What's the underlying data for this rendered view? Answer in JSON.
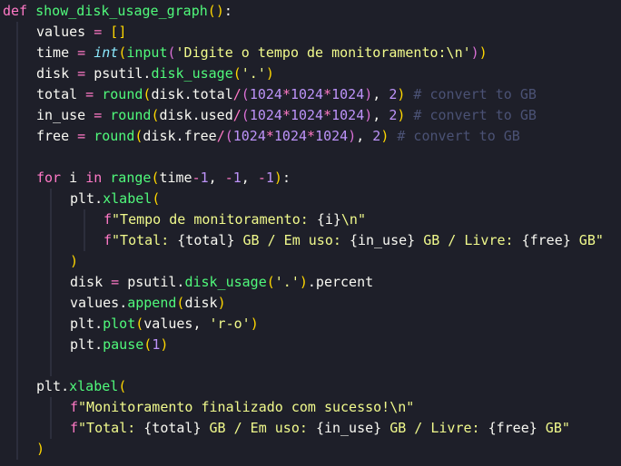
{
  "colors": {
    "background": "#1e1f29",
    "kw": "#ff79c6",
    "fn": "#50fa7b",
    "var": "#f8f8f2",
    "op": "#ff79c6",
    "str": "#f1fa8c",
    "num": "#bd93f9",
    "cmt": "#4b5275",
    "p1": "#ffd700",
    "p2": "#da70d6",
    "p3": "#179fff",
    "guide": "#3a3d4f"
  },
  "code": {
    "lines": [
      {
        "indent": 0,
        "tokens": [
          {
            "t": "def",
            "c": "kw"
          },
          {
            "t": " ",
            "c": "var"
          },
          {
            "t": "show_disk_usage_graph",
            "c": "fn"
          },
          {
            "t": "(",
            "c": "p1"
          },
          {
            "t": ")",
            "c": "p1"
          },
          {
            "t": ":",
            "c": "var"
          }
        ]
      },
      {
        "indent": 1,
        "tokens": [
          {
            "t": "values",
            "c": "var"
          },
          {
            "t": " = ",
            "c": "op"
          },
          {
            "t": "[",
            "c": "p1"
          },
          {
            "t": "]",
            "c": "p1"
          }
        ]
      },
      {
        "indent": 1,
        "tokens": [
          {
            "t": "time",
            "c": "var"
          },
          {
            "t": " = ",
            "c": "op"
          },
          {
            "t": "int",
            "c": "kwi"
          },
          {
            "t": "(",
            "c": "p1"
          },
          {
            "t": "input",
            "c": "fn"
          },
          {
            "t": "(",
            "c": "p2"
          },
          {
            "t": "'Digite o tempo de monitoramento:\\n'",
            "c": "str"
          },
          {
            "t": ")",
            "c": "p2"
          },
          {
            "t": ")",
            "c": "p1"
          }
        ]
      },
      {
        "indent": 1,
        "tokens": [
          {
            "t": "disk",
            "c": "var"
          },
          {
            "t": " = ",
            "c": "op"
          },
          {
            "t": "psutil",
            "c": "var"
          },
          {
            "t": ".",
            "c": "var"
          },
          {
            "t": "disk_usage",
            "c": "fn"
          },
          {
            "t": "(",
            "c": "p1"
          },
          {
            "t": "'.'",
            "c": "str"
          },
          {
            "t": ")",
            "c": "p1"
          }
        ]
      },
      {
        "indent": 1,
        "tokens": [
          {
            "t": "total",
            "c": "var"
          },
          {
            "t": " = ",
            "c": "op"
          },
          {
            "t": "round",
            "c": "fn"
          },
          {
            "t": "(",
            "c": "p1"
          },
          {
            "t": "disk",
            "c": "var"
          },
          {
            "t": ".",
            "c": "var"
          },
          {
            "t": "total",
            "c": "var"
          },
          {
            "t": "/",
            "c": "op"
          },
          {
            "t": "(",
            "c": "p2"
          },
          {
            "t": "1024",
            "c": "num"
          },
          {
            "t": "*",
            "c": "op"
          },
          {
            "t": "1024",
            "c": "num"
          },
          {
            "t": "*",
            "c": "op"
          },
          {
            "t": "1024",
            "c": "num"
          },
          {
            "t": ")",
            "c": "p2"
          },
          {
            "t": ", ",
            "c": "var"
          },
          {
            "t": "2",
            "c": "num"
          },
          {
            "t": ")",
            "c": "p1"
          },
          {
            "t": " # convert to GB",
            "c": "cmt"
          }
        ]
      },
      {
        "indent": 1,
        "tokens": [
          {
            "t": "in_use",
            "c": "var"
          },
          {
            "t": " = ",
            "c": "op"
          },
          {
            "t": "round",
            "c": "fn"
          },
          {
            "t": "(",
            "c": "p1"
          },
          {
            "t": "disk",
            "c": "var"
          },
          {
            "t": ".",
            "c": "var"
          },
          {
            "t": "used",
            "c": "var"
          },
          {
            "t": "/",
            "c": "op"
          },
          {
            "t": "(",
            "c": "p2"
          },
          {
            "t": "1024",
            "c": "num"
          },
          {
            "t": "*",
            "c": "op"
          },
          {
            "t": "1024",
            "c": "num"
          },
          {
            "t": "*",
            "c": "op"
          },
          {
            "t": "1024",
            "c": "num"
          },
          {
            "t": ")",
            "c": "p2"
          },
          {
            "t": ", ",
            "c": "var"
          },
          {
            "t": "2",
            "c": "num"
          },
          {
            "t": ")",
            "c": "p1"
          },
          {
            "t": " # convert to GB",
            "c": "cmt"
          }
        ]
      },
      {
        "indent": 1,
        "tokens": [
          {
            "t": "free",
            "c": "var"
          },
          {
            "t": " = ",
            "c": "op"
          },
          {
            "t": "round",
            "c": "fn"
          },
          {
            "t": "(",
            "c": "p1"
          },
          {
            "t": "disk",
            "c": "var"
          },
          {
            "t": ".",
            "c": "var"
          },
          {
            "t": "free",
            "c": "var"
          },
          {
            "t": "/",
            "c": "op"
          },
          {
            "t": "(",
            "c": "p2"
          },
          {
            "t": "1024",
            "c": "num"
          },
          {
            "t": "*",
            "c": "op"
          },
          {
            "t": "1024",
            "c": "num"
          },
          {
            "t": "*",
            "c": "op"
          },
          {
            "t": "1024",
            "c": "num"
          },
          {
            "t": ")",
            "c": "p2"
          },
          {
            "t": ", ",
            "c": "var"
          },
          {
            "t": "2",
            "c": "num"
          },
          {
            "t": ")",
            "c": "p1"
          },
          {
            "t": " # convert to GB",
            "c": "cmt"
          }
        ]
      },
      {
        "indent": 0,
        "tokens": []
      },
      {
        "indent": 1,
        "tokens": [
          {
            "t": "for",
            "c": "kw"
          },
          {
            "t": " i ",
            "c": "var"
          },
          {
            "t": "in",
            "c": "kw"
          },
          {
            "t": " ",
            "c": "var"
          },
          {
            "t": "range",
            "c": "fn"
          },
          {
            "t": "(",
            "c": "p1"
          },
          {
            "t": "time",
            "c": "var"
          },
          {
            "t": "-",
            "c": "op"
          },
          {
            "t": "1",
            "c": "num"
          },
          {
            "t": ", ",
            "c": "var"
          },
          {
            "t": "-",
            "c": "op"
          },
          {
            "t": "1",
            "c": "num"
          },
          {
            "t": ", ",
            "c": "var"
          },
          {
            "t": "-",
            "c": "op"
          },
          {
            "t": "1",
            "c": "num"
          },
          {
            "t": ")",
            "c": "p1"
          },
          {
            "t": ":",
            "c": "var"
          }
        ]
      },
      {
        "indent": 2,
        "tokens": [
          {
            "t": "plt",
            "c": "var"
          },
          {
            "t": ".",
            "c": "var"
          },
          {
            "t": "xlabel",
            "c": "fn"
          },
          {
            "t": "(",
            "c": "p1"
          }
        ]
      },
      {
        "indent": 3,
        "tokens": [
          {
            "t": "f",
            "c": "kw"
          },
          {
            "t": "\"Tempo de monitoramento: ",
            "c": "str"
          },
          {
            "t": "{i}",
            "c": "var"
          },
          {
            "t": "\\n\"",
            "c": "str"
          }
        ]
      },
      {
        "indent": 3,
        "tokens": [
          {
            "t": "f",
            "c": "kw"
          },
          {
            "t": "\"Total: ",
            "c": "str"
          },
          {
            "t": "{total}",
            "c": "var"
          },
          {
            "t": " GB / Em uso: ",
            "c": "str"
          },
          {
            "t": "{in_use}",
            "c": "var"
          },
          {
            "t": " GB / Livre: ",
            "c": "str"
          },
          {
            "t": "{free}",
            "c": "var"
          },
          {
            "t": " GB\"",
            "c": "str"
          }
        ]
      },
      {
        "indent": 2,
        "tokens": [
          {
            "t": ")",
            "c": "p1"
          }
        ]
      },
      {
        "indent": 2,
        "tokens": [
          {
            "t": "disk",
            "c": "var"
          },
          {
            "t": " = ",
            "c": "op"
          },
          {
            "t": "psutil",
            "c": "var"
          },
          {
            "t": ".",
            "c": "var"
          },
          {
            "t": "disk_usage",
            "c": "fn"
          },
          {
            "t": "(",
            "c": "p1"
          },
          {
            "t": "'.'",
            "c": "str"
          },
          {
            "t": ")",
            "c": "p1"
          },
          {
            "t": ".percent",
            "c": "var"
          }
        ]
      },
      {
        "indent": 2,
        "tokens": [
          {
            "t": "values",
            "c": "var"
          },
          {
            "t": ".",
            "c": "var"
          },
          {
            "t": "append",
            "c": "fn"
          },
          {
            "t": "(",
            "c": "p1"
          },
          {
            "t": "disk",
            "c": "var"
          },
          {
            "t": ")",
            "c": "p1"
          }
        ]
      },
      {
        "indent": 2,
        "tokens": [
          {
            "t": "plt",
            "c": "var"
          },
          {
            "t": ".",
            "c": "var"
          },
          {
            "t": "plot",
            "c": "fn"
          },
          {
            "t": "(",
            "c": "p1"
          },
          {
            "t": "values, ",
            "c": "var"
          },
          {
            "t": "'r-o'",
            "c": "str"
          },
          {
            "t": ")",
            "c": "p1"
          }
        ]
      },
      {
        "indent": 2,
        "tokens": [
          {
            "t": "plt",
            "c": "var"
          },
          {
            "t": ".",
            "c": "var"
          },
          {
            "t": "pause",
            "c": "fn"
          },
          {
            "t": "(",
            "c": "p1"
          },
          {
            "t": "1",
            "c": "num"
          },
          {
            "t": ")",
            "c": "p1"
          }
        ]
      },
      {
        "indent": 0,
        "tokens": []
      },
      {
        "indent": 1,
        "tokens": [
          {
            "t": "plt",
            "c": "var"
          },
          {
            "t": ".",
            "c": "var"
          },
          {
            "t": "xlabel",
            "c": "fn"
          },
          {
            "t": "(",
            "c": "p1"
          }
        ]
      },
      {
        "indent": 2,
        "tokens": [
          {
            "t": "f",
            "c": "kw"
          },
          {
            "t": "\"Monitoramento finalizado com sucesso!\\n\"",
            "c": "str"
          }
        ]
      },
      {
        "indent": 2,
        "tokens": [
          {
            "t": "f",
            "c": "kw"
          },
          {
            "t": "\"Total: ",
            "c": "str"
          },
          {
            "t": "{total}",
            "c": "var"
          },
          {
            "t": " GB / Em uso: ",
            "c": "str"
          },
          {
            "t": "{in_use}",
            "c": "var"
          },
          {
            "t": " GB / Livre: ",
            "c": "str"
          },
          {
            "t": "{free}",
            "c": "var"
          },
          {
            "t": " GB\"",
            "c": "str"
          }
        ]
      },
      {
        "indent": 1,
        "tokens": [
          {
            "t": ")",
            "c": "p1"
          }
        ]
      }
    ]
  }
}
